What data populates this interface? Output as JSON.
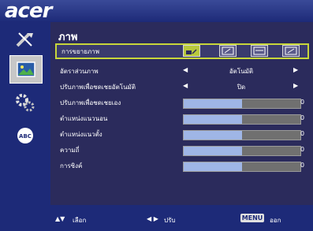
{
  "brand": {
    "logo_text": "acer"
  },
  "sidebar": {
    "items": [
      {
        "icon": "wrench-screwdriver-icon",
        "active": false
      },
      {
        "icon": "picture-icon",
        "active": true
      },
      {
        "icon": "gear-icon",
        "active": false
      },
      {
        "icon": "abc-language-icon",
        "active": false
      }
    ]
  },
  "panel": {
    "title": "ภาพ",
    "rows": {
      "aspect": {
        "label": "การขยายภาพ"
      },
      "projection": {
        "label": "อัตราส่วนภาพ",
        "value": "อัตโนมัติ"
      },
      "auto_keystone": {
        "label": "ปรับภาพเพื่อชดเชยอัตโนมัติ",
        "value": "ปิด"
      },
      "manual_keystone": {
        "label": "ปรับภาพเพื่อชดเชยเอง",
        "value": "0",
        "level": 0.5
      },
      "h_position": {
        "label": "ตำแหน่งแนวนอน",
        "value": "0",
        "level": 0.5
      },
      "v_position": {
        "label": "ตำแหน่งแนวตั้ง",
        "value": "0",
        "level": 0.5
      },
      "frequency": {
        "label": "ความถี่",
        "value": "0",
        "level": 0.5
      },
      "tracking": {
        "label": "การซิงค์",
        "value": "0",
        "level": 0.5
      }
    }
  },
  "footer": {
    "select_label": "เลือก",
    "adjust_label": "ปรับ",
    "menu_key": "MENU",
    "exit_label": "ออก"
  },
  "colors": {
    "background": "#1d2a78",
    "highlight": "#c8d63a",
    "bar_fill": "#9fb6e6"
  }
}
